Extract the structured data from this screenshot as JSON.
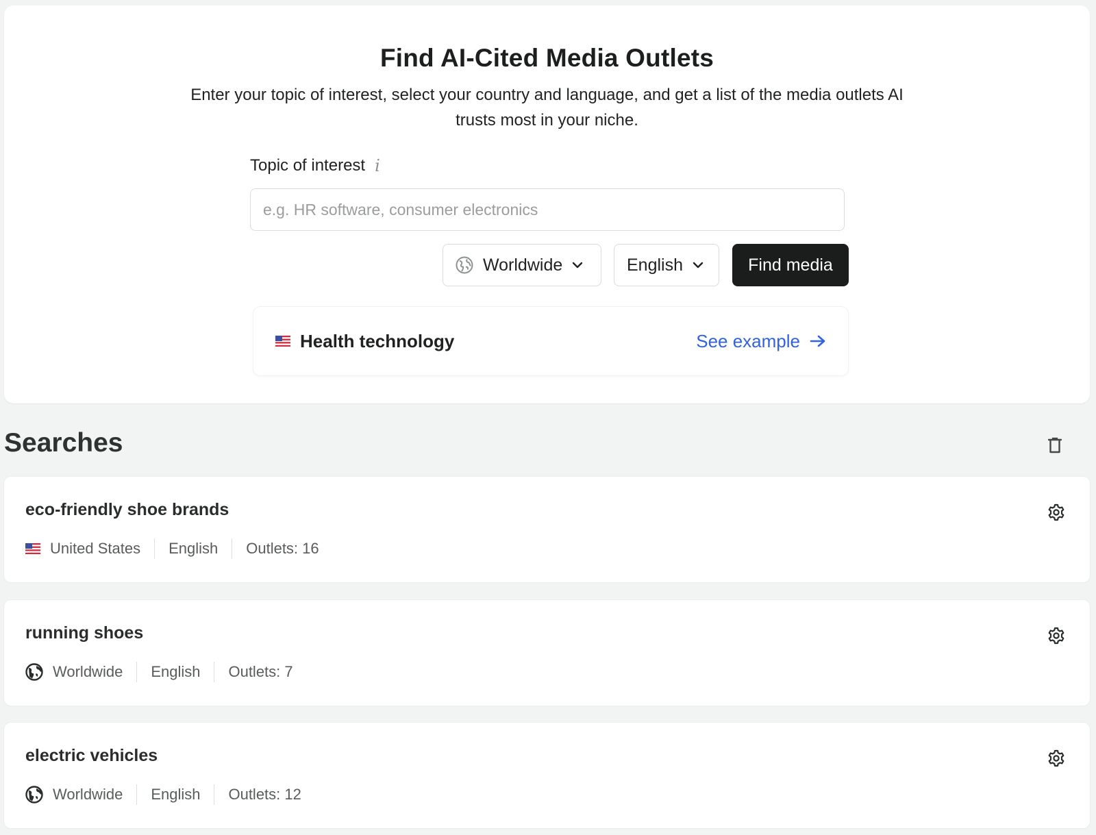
{
  "header": {
    "title": "Find AI-Cited Media Outlets",
    "subtitle": "Enter your topic of interest, select your country and language, and get a list of the media outlets AI trusts most in your niche."
  },
  "form": {
    "topic_label": "Topic of interest",
    "topic_info_icon": "i",
    "topic_placeholder": "e.g. HR software, consumer electronics",
    "topic_value": "",
    "country": "Worldwide",
    "language": "English",
    "submit_label": "Find media"
  },
  "example": {
    "flag": "us-flag-icon",
    "topic": "Health technology",
    "link_label": "See example"
  },
  "searches": {
    "title": "Searches",
    "items": [
      {
        "name": "eco-friendly shoe brands",
        "icon": "us-flag-icon",
        "country": "United States",
        "language": "English",
        "outlets": "Outlets: 16"
      },
      {
        "name": "running shoes",
        "icon": "globe-icon",
        "country": "Worldwide",
        "language": "English",
        "outlets": "Outlets: 7"
      },
      {
        "name": "electric vehicles",
        "icon": "globe-icon",
        "country": "Worldwide",
        "language": "English",
        "outlets": "Outlets: 12"
      }
    ]
  },
  "colors": {
    "page_bg": "#f2f4f3",
    "primary_button": "#1b1d1c",
    "link": "#2f62e6"
  }
}
